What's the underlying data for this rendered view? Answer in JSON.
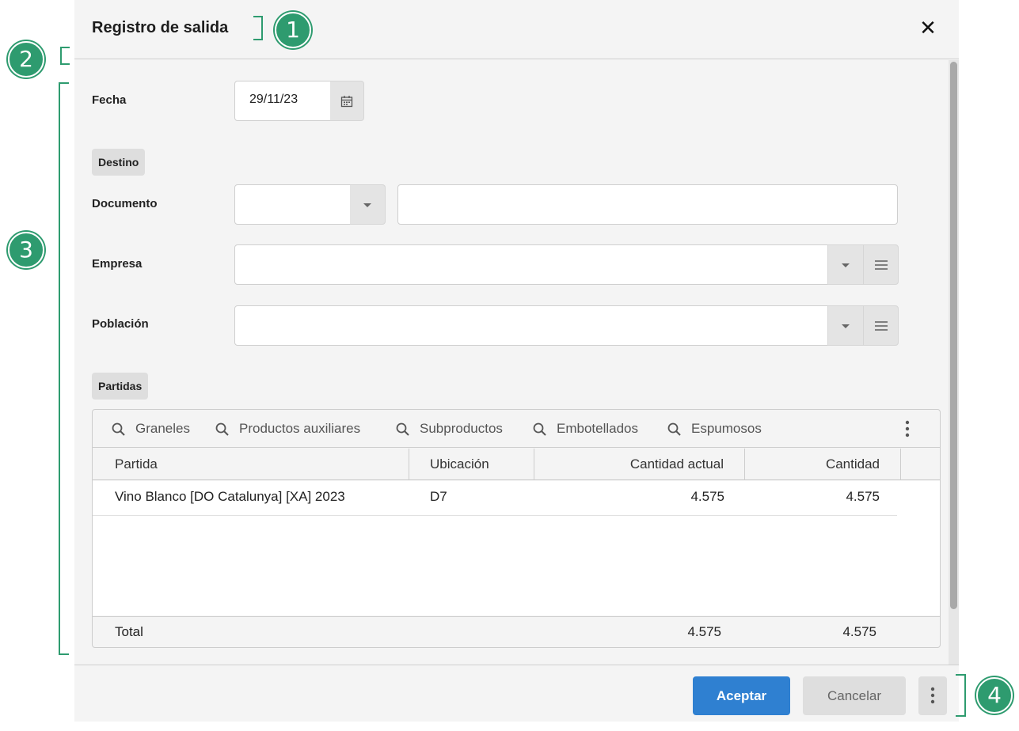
{
  "dialog": {
    "title": "Registro de salida",
    "close_icon": "close-icon"
  },
  "form": {
    "fecha_label": "Fecha",
    "fecha_value": "29/11/23",
    "destino_chip": "Destino",
    "documento_label": "Documento",
    "empresa_label": "Empresa",
    "poblacion_label": "Población",
    "partidas_chip": "Partidas"
  },
  "grid": {
    "toolbar": [
      "Graneles",
      "Productos auxiliares",
      "Subproductos",
      "Embotellados",
      "Espumosos"
    ],
    "columns": [
      "Partida",
      "Ubicación",
      "Cantidad actual",
      "Cantidad"
    ],
    "rows": [
      {
        "partida": "Vino Blanco [DO Catalunya] [XA] 2023",
        "ubicacion": "D7",
        "cantidad_actual": "4.575",
        "cantidad": "4.575"
      }
    ],
    "footer": {
      "label": "Total",
      "cantidad_actual": "4.575",
      "cantidad": "4.575"
    }
  },
  "footer": {
    "accept_label": "Aceptar",
    "cancel_label": "Cancelar"
  },
  "annotations": [
    "1",
    "2",
    "3",
    "4"
  ],
  "colors": {
    "accent": "#2f80d1",
    "annotation": "#2e9b6f",
    "dialog_bg": "#f4f4f4"
  }
}
